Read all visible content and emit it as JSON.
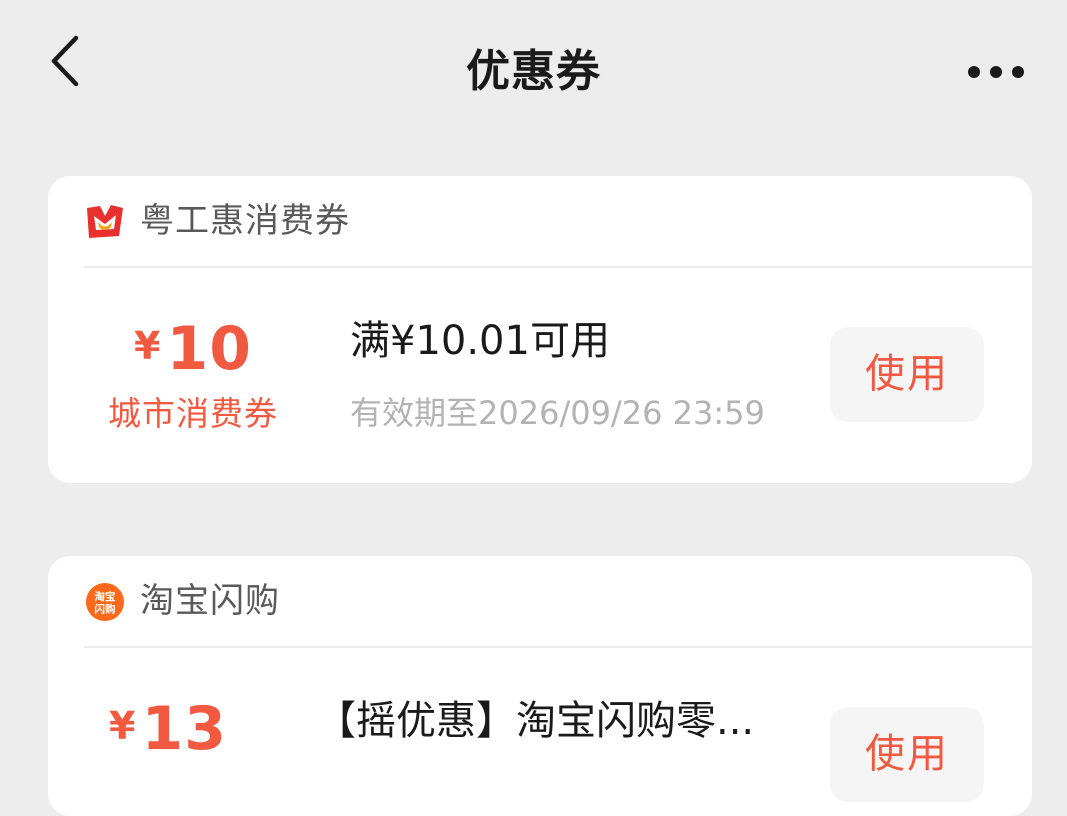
{
  "header": {
    "title": "优惠券"
  },
  "coupons": [
    {
      "brand": "粤工惠消费券",
      "brand_icon": "yuegonghui-logo-icon",
      "currency": "¥",
      "amount": "10",
      "type_label": "城市消费券",
      "condition": "满¥10.01可用",
      "expire": "有效期至2026/09/26 23:59",
      "button": "使用"
    },
    {
      "brand": "淘宝闪购",
      "brand_icon": "taobao-shangou-logo-icon",
      "brand_icon_text": "淘宝闪购",
      "currency": "¥",
      "amount": "13",
      "condition": "【摇优惠】淘宝闪购零...",
      "button": "使用"
    }
  ],
  "colors": {
    "background": "#ededed",
    "card": "#ffffff",
    "accent": "#f15a40",
    "muted": "#b3b3b3",
    "button_bg": "#f5f5f5"
  }
}
